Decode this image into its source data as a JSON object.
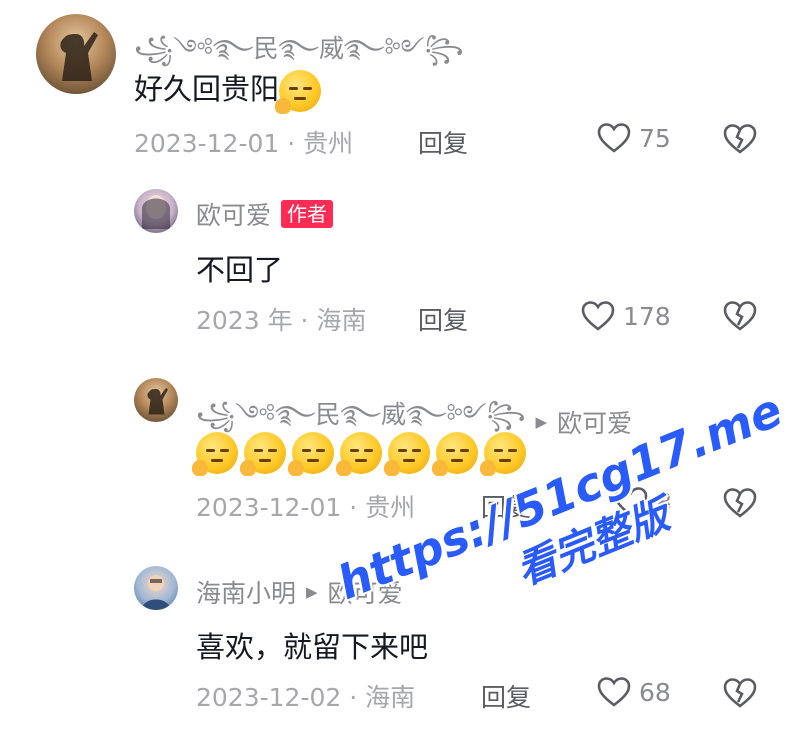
{
  "comments": [
    {
      "name": "꧁༺࿐民࿐威࿐༻꧂",
      "text": "好久回贵阳",
      "emoji_count": 1,
      "date": "2023-12-01",
      "location": "贵州",
      "reply_label": "回复",
      "likes": "75"
    },
    {
      "name": "欧可爱",
      "badge": "作者",
      "text": "不回了",
      "date": "2023 年",
      "location": "海南",
      "reply_label": "回复",
      "likes": "178"
    },
    {
      "name": "꧁༺࿐民࿐威࿐༻꧂",
      "reply_to": "欧可爱",
      "emoji_count": 7,
      "date": "2023-12-01",
      "location": "贵州",
      "reply_label": "回复",
      "likes": "8"
    },
    {
      "name": "海南小明",
      "reply_to": "欧可爱",
      "text": "喜欢，就留下来吧",
      "date": "2023-12-02",
      "location": "海南",
      "reply_label": "回复",
      "likes": "68"
    }
  ],
  "separator": "·",
  "icons": {
    "like": "heart-outline-icon",
    "dislike": "broken-heart-icon",
    "reply_arrow": "triangle-right-icon",
    "emoji": "thinking-face-emoji"
  },
  "colors": {
    "badge": "#fe2c55",
    "watermark": "#2a5bff"
  },
  "watermark": {
    "line1": "https://51cg17.me",
    "line2": "看完整版"
  }
}
